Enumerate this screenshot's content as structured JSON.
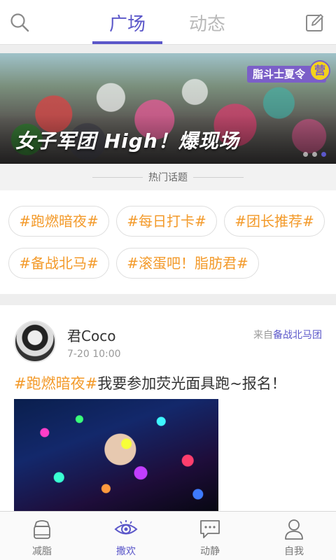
{
  "header": {
    "tabs": [
      {
        "label": "广场",
        "active": true
      },
      {
        "label": "动态",
        "active": false
      }
    ],
    "accent_color": "#5b57c9",
    "icons": {
      "left": "search-icon",
      "right": "edit-icon"
    }
  },
  "banner": {
    "title": "女子军团 High！爆现场",
    "badge": "脂斗士夏令",
    "badge_mark": "营",
    "slides_total": 3,
    "active_slide": 3
  },
  "hot_topics": {
    "title": "热门话题",
    "tags": [
      "#跑燃暗夜#",
      "#每日打卡#",
      "#团长推荐#",
      "#备战北马#",
      "#滚蛋吧！脂肪君#"
    ],
    "tag_color": "#f39a2a"
  },
  "post": {
    "author": "君Coco",
    "time": "7-20 10:00",
    "from_prefix": "来自",
    "from_team": "备战北马团",
    "topic": "#跑燃暗夜#",
    "text": "我要参加荧光面具跑~报名！"
  },
  "bottom_nav": {
    "items": [
      {
        "label": "减脂",
        "icon": "scale-icon",
        "active": false
      },
      {
        "label": "撒欢",
        "icon": "eye-icon",
        "active": true
      },
      {
        "label": "动静",
        "icon": "chat-icon",
        "active": false
      },
      {
        "label": "自我",
        "icon": "person-icon",
        "active": false
      }
    ]
  }
}
